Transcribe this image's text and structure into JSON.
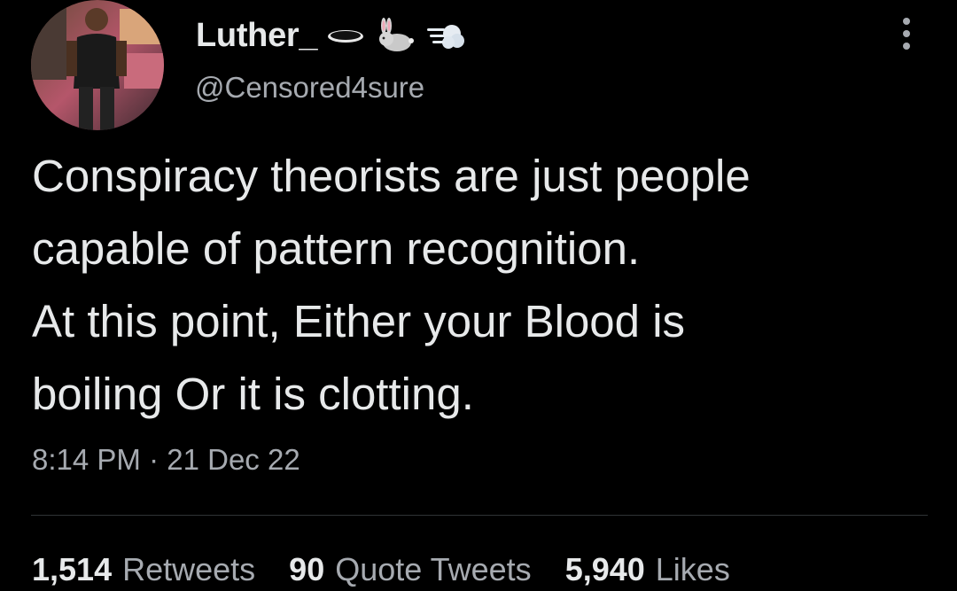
{
  "tweet": {
    "display_name": "Luther_",
    "name_emojis": [
      "hole-emoji",
      "rabbit-emoji",
      "dash-emoji"
    ],
    "handle": "@Censored4sure",
    "text": "Conspiracy theorists are just people\ncapable of pattern recognition.\nAt this point, Either your Blood is\nboiling Or it is clotting.",
    "time": "8:14 PM",
    "separator": "·",
    "date": "21 Dec 22",
    "stats": {
      "retweets_count": "1,514",
      "retweets_label": "Retweets",
      "quotes_count": "90",
      "quotes_label": "Quote Tweets",
      "likes_count": "5,940",
      "likes_label": "Likes"
    }
  },
  "colors": {
    "background": "#000000",
    "primary_text": "#e7e9ea",
    "secondary_text": "#a6aab0",
    "divider": "#2f3336"
  }
}
